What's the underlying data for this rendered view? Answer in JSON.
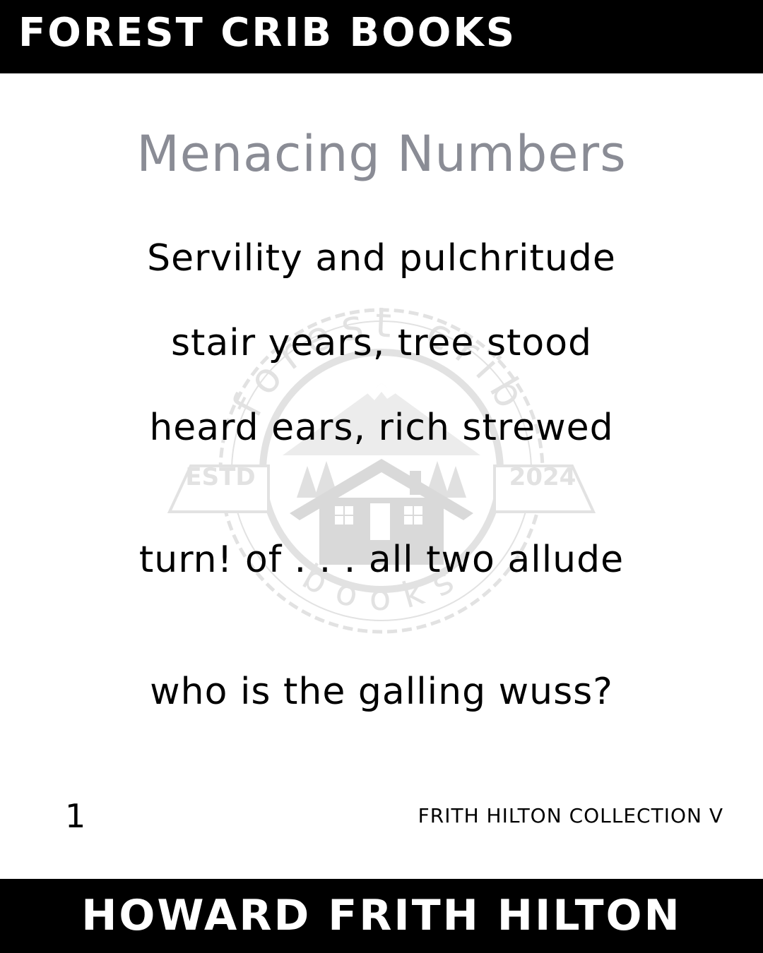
{
  "header": {
    "publisher": "FOREST CRIB BOOKS"
  },
  "watermark": {
    "top_text": "forest crib",
    "bottom_text": "books",
    "left_text": "ESTD",
    "right_text": "2024",
    "color": "#e2e2e2",
    "icon": "cabin-mountain-logo-icon"
  },
  "poem": {
    "title": "Menacing Numbers",
    "lines": [
      "Servility and pulchritude",
      "stair years, tree stood",
      "heard ears, rich strewed",
      "turn! of . . . all two allude",
      "who is the galling wuss?"
    ]
  },
  "footer": {
    "page_number": "1",
    "collection": "FRITH HILTON COLLECTION V",
    "author": "HOWARD FRITH HILTON"
  },
  "colors": {
    "bar": "#000000",
    "title": "#8a8c95",
    "text": "#000000"
  }
}
